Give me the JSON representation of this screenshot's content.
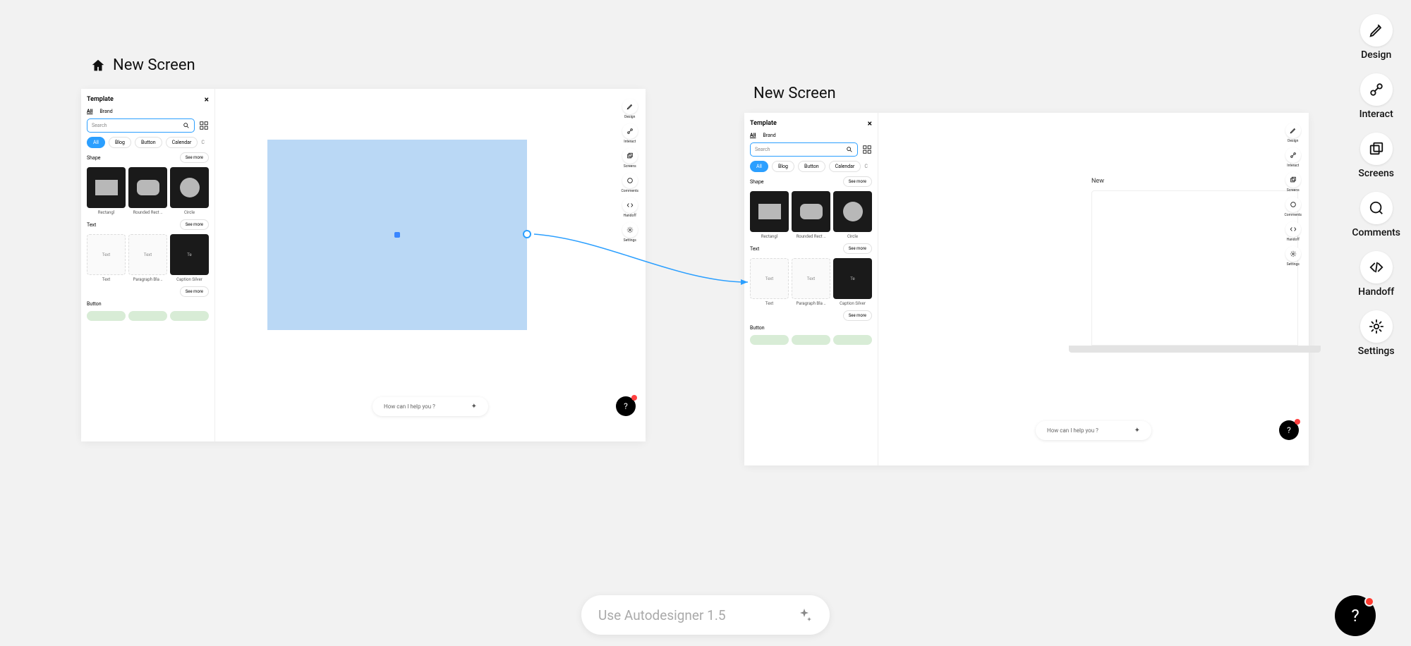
{
  "sidebar": {
    "items": [
      {
        "icon": "pencil-icon",
        "label": "Design"
      },
      {
        "icon": "connect-icon",
        "label": "Interact"
      },
      {
        "icon": "screens-icon",
        "label": "Screens"
      },
      {
        "icon": "comment-icon",
        "label": "Comments"
      },
      {
        "icon": "code-icon",
        "label": "Handoff"
      },
      {
        "icon": "gear-icon",
        "label": "Settings"
      }
    ]
  },
  "frames": {
    "frame1_title": "New Screen",
    "frame2_title": "New Screen"
  },
  "template_panel": {
    "title": "Template",
    "tabs": {
      "all": "All",
      "brand": "Brand"
    },
    "search_placeholder": "Search",
    "chips": {
      "all": "All",
      "blog": "Blog",
      "button": "Button",
      "calendar": "Calendar",
      "more": "C"
    },
    "sections": {
      "shape": "Shape",
      "text": "Text",
      "button": "Button",
      "see_more": "See more"
    },
    "shapes": {
      "rect": "Rectangl",
      "rrect": "Rounded Rect ..",
      "circle": "Circle"
    },
    "texts": {
      "t1": "Text",
      "t2": "Text",
      "t3": "Paragraph Bla ..",
      "t4": "Caption Silver"
    }
  },
  "canvas": {
    "preview_label": "New",
    "help_placeholder": "How can I help you ?"
  },
  "autodesigner": {
    "placeholder": "Use Autodesigner 1.5"
  },
  "icons": {
    "sparkle": "✦"
  }
}
